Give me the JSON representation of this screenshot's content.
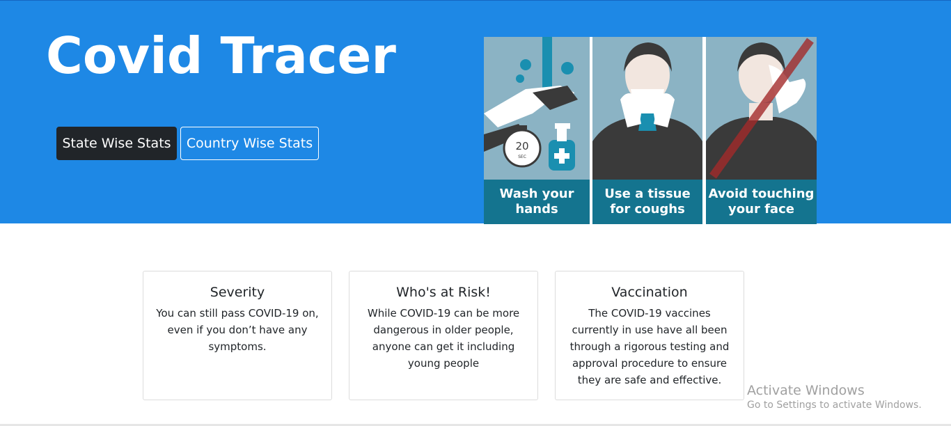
{
  "header": {
    "title": "Covid Tracer",
    "buttons": {
      "state_wise": "State Wise Stats",
      "country_wise": "Country Wise Stats"
    }
  },
  "poster": {
    "panels": [
      {
        "line1": "Wash your",
        "line2": "hands",
        "icon": "hand-washing-icon"
      },
      {
        "line1": "Use a tissue",
        "line2": "for coughs",
        "icon": "tissue-cough-icon"
      },
      {
        "line1": "Avoid touching",
        "line2": "your face",
        "icon": "avoid-face-touch-icon"
      }
    ],
    "timer_text": "20",
    "timer_unit": "SEC"
  },
  "cards": [
    {
      "title": "Severity",
      "text": "You can still pass COVID-19 on, even if you don’t have any symptoms."
    },
    {
      "title": "Who's at Risk!",
      "text": "While COVID-19 can be more dangerous in older people, anyone can get it including young people"
    },
    {
      "title": "Vaccination",
      "text": "The COVID-19 vaccines currently in use have all been through a rigorous testing and approval procedure to ensure they are safe and effective."
    }
  ],
  "watermark": {
    "line1": "Activate Windows",
    "line2": "Go to Settings to activate Windows."
  },
  "colors": {
    "hero_bg": "#1e88e5",
    "dark_button": "#212529",
    "poster_teal": "#14748f"
  }
}
